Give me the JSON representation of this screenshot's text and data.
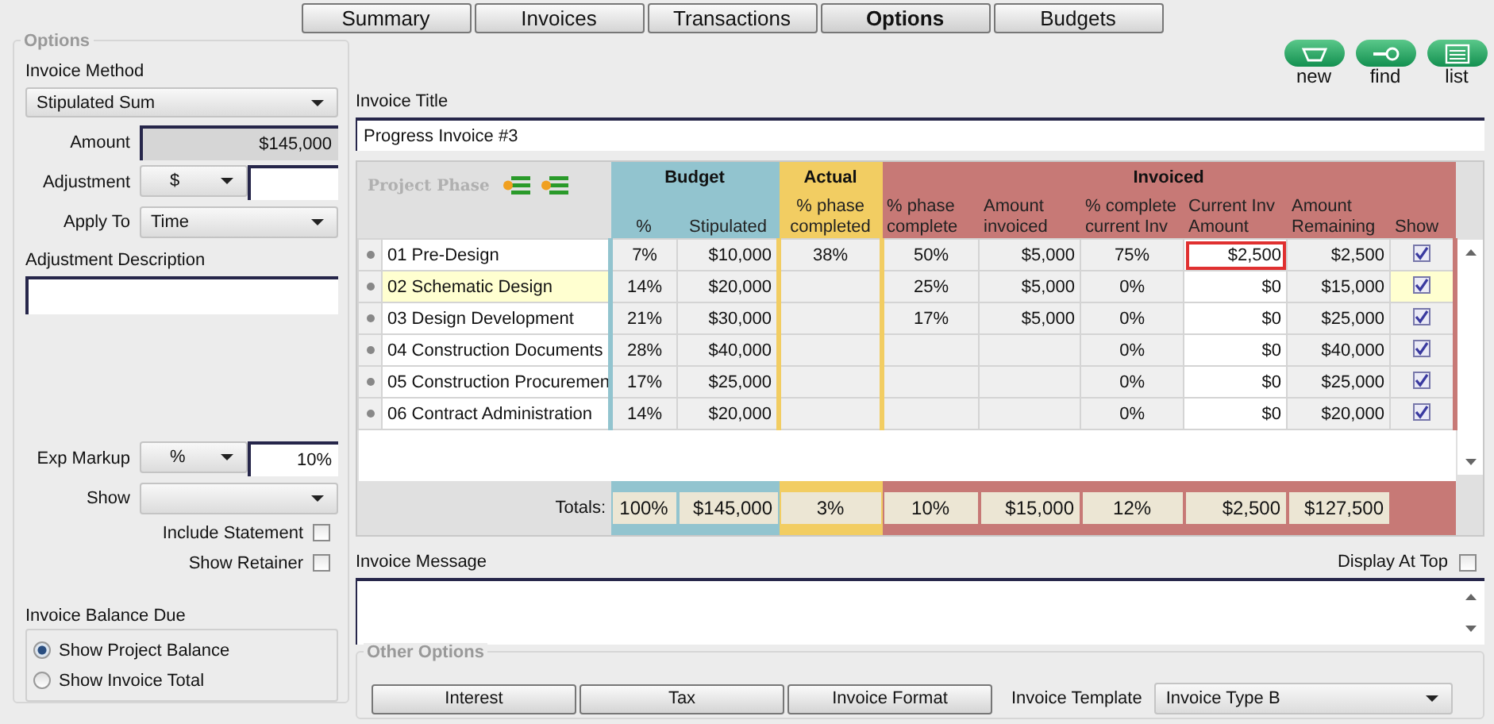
{
  "tabs": [
    {
      "label": "Summary",
      "selected": false
    },
    {
      "label": "Invoices",
      "selected": false
    },
    {
      "label": "Transactions",
      "selected": false
    },
    {
      "label": "Options",
      "selected": true
    },
    {
      "label": "Budgets",
      "selected": false
    }
  ],
  "toolbar": [
    {
      "label": "new",
      "kind": "new"
    },
    {
      "label": "find",
      "kind": "find"
    },
    {
      "label": "list",
      "kind": "list"
    }
  ],
  "options_panel": {
    "title": "Options",
    "invoice_method": {
      "label": "Invoice Method",
      "value": "Stipulated Sum"
    },
    "amount": {
      "label": "Amount",
      "value": "$145,000"
    },
    "adjustment": {
      "label": "Adjustment",
      "unit": "$"
    },
    "apply_to": {
      "label": "Apply To",
      "value": "Time"
    },
    "adjustment_description": {
      "label": "Adjustment Description"
    },
    "exp_markup": {
      "label": "Exp Markup",
      "unit": "%",
      "value": "10%"
    },
    "show": {
      "label": "Show"
    },
    "checks": [
      {
        "label": "Include Statement",
        "checked": false
      },
      {
        "label": "Show Retainer",
        "checked": false
      }
    ],
    "invoice_balance_due": {
      "label": "Invoice Balance Due",
      "options": [
        {
          "label": "Show Project Balance",
          "selected": true
        },
        {
          "label": "Show Invoice Total",
          "selected": false
        }
      ]
    }
  },
  "invoice_title": {
    "label": "Invoice Title",
    "value": "Progress Invoice #3"
  },
  "table": {
    "phase_header": "Project Phase",
    "groups": [
      {
        "label": "Budget",
        "kind": "budget",
        "columns": [
          "%",
          "Stipulated"
        ]
      },
      {
        "label": "Actual",
        "kind": "actual",
        "columns": [
          "% phase completed"
        ]
      },
      {
        "label": "Invoiced",
        "kind": "invoiced",
        "columns": [
          "% phase complete",
          "Amount invoiced",
          "% complete current Inv",
          "Current Inv Amount",
          "Amount Remaining",
          "Show"
        ]
      }
    ],
    "rows": [
      {
        "phase": "01 Pre-Design",
        "selected": false,
        "budget_pct": "7%",
        "stipulated": "$10,000",
        "actual_pct": "38%",
        "phase_complete": "50%",
        "amount_invoiced": "$5,000",
        "complete_current": "75%",
        "current_amount": "$2,500",
        "editing": true,
        "remaining": "$2,500",
        "show": true
      },
      {
        "phase": "02 Schematic Design",
        "selected": true,
        "budget_pct": "14%",
        "stipulated": "$20,000",
        "phase_complete": "25%",
        "amount_invoiced": "$5,000",
        "complete_current": "0%",
        "current_amount": "$0",
        "editing": false,
        "remaining": "$15,000",
        "show": true
      },
      {
        "phase": "03 Design Development",
        "selected": false,
        "budget_pct": "21%",
        "stipulated": "$30,000",
        "phase_complete": "17%",
        "amount_invoiced": "$5,000",
        "complete_current": "0%",
        "current_amount": "$0",
        "editing": false,
        "remaining": "$25,000",
        "show": true
      },
      {
        "phase": "04 Construction Documents",
        "selected": false,
        "budget_pct": "28%",
        "stipulated": "$40,000",
        "complete_current": "0%",
        "current_amount": "$0",
        "editing": false,
        "remaining": "$40,000",
        "show": true
      },
      {
        "phase": "05 Construction Procuremen",
        "selected": false,
        "budget_pct": "17%",
        "stipulated": "$25,000",
        "complete_current": "0%",
        "current_amount": "$0",
        "editing": false,
        "remaining": "$25,000",
        "show": true
      },
      {
        "phase": "06 Contract Administration",
        "selected": false,
        "budget_pct": "14%",
        "stipulated": "$20,000",
        "complete_current": "0%",
        "current_amount": "$0",
        "editing": false,
        "remaining": "$20,000",
        "show": true
      }
    ],
    "totals": {
      "label": "Totals:",
      "budget_pct": "100%",
      "stipulated": "$145,000",
      "actual_pct": "3%",
      "phase_complete": "10%",
      "amount_invoiced": "$15,000",
      "complete_current": "12%",
      "current_amount": "$2,500",
      "remaining": "$127,500"
    }
  },
  "invoice_message": {
    "label": "Invoice Message",
    "display_at_top": {
      "label": "Display At Top",
      "checked": false
    }
  },
  "other_options": {
    "title": "Other Options",
    "buttons": [
      "Interest",
      "Tax",
      "Invoice Format"
    ],
    "template": {
      "label": "Invoice Template",
      "value": "Invoice Type B"
    }
  }
}
